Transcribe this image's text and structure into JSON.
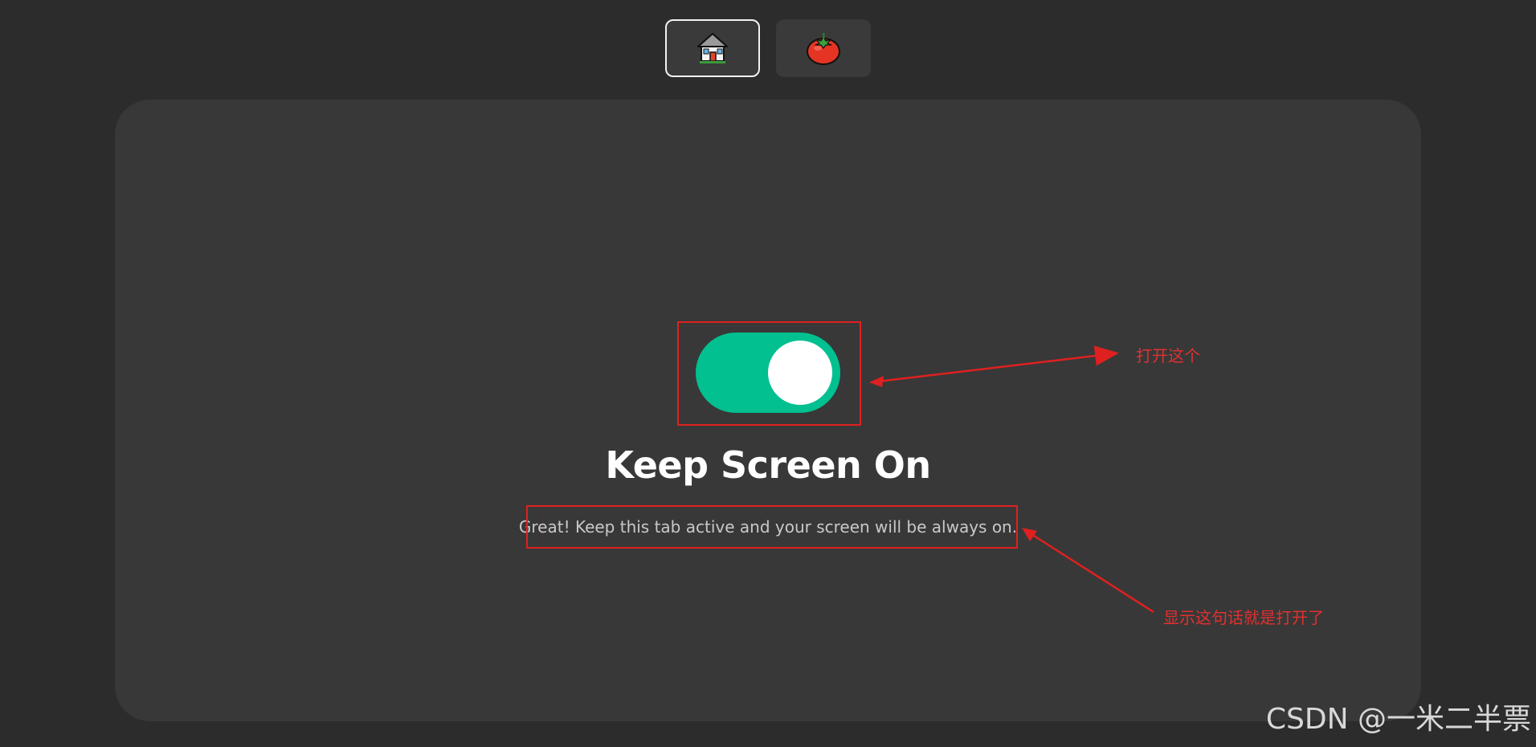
{
  "nav": {
    "items": [
      {
        "icon": "house-icon",
        "active": true
      },
      {
        "icon": "tomato-icon",
        "active": false
      }
    ]
  },
  "main": {
    "toggle": {
      "state": "on",
      "color": "#02c090"
    },
    "title": "Keep Screen On",
    "status": "Great! Keep this tab active and your screen will be always on."
  },
  "annotations": {
    "toggle_note": "打开这个",
    "status_note": "显示这句话就是打开了",
    "color": "#e02020"
  },
  "watermark": "CSDN @一米二半票"
}
